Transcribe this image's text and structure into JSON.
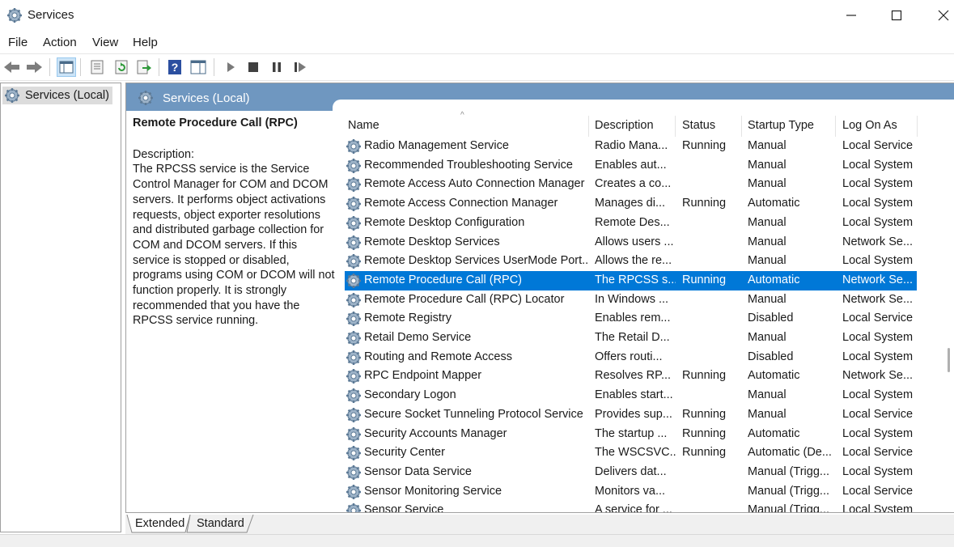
{
  "window": {
    "title": "Services"
  },
  "menu": [
    "File",
    "Action",
    "View",
    "Help"
  ],
  "tree": {
    "root_label": "Services (Local)"
  },
  "main": {
    "header_label": "Services (Local)",
    "selected_service_name": "Remote Procedure Call (RPC)",
    "description_label": "Description:",
    "description_text": "The RPCSS service is the Service Control Manager for COM and DCOM servers. It performs object activations requests, object exporter resolutions and distributed garbage collection for COM and DCOM servers. If this service is stopped or disabled, programs using COM or DCOM will not function properly. It is strongly recommended that you have the RPCSS service running."
  },
  "columns": [
    "Name",
    "Description",
    "Status",
    "Startup Type",
    "Log On As"
  ],
  "services": [
    {
      "name": "Radio Management Service",
      "description": "Radio Mana...",
      "status": "Running",
      "startup": "Manual",
      "logon": "Local Service"
    },
    {
      "name": "Recommended Troubleshooting Service",
      "description": "Enables aut...",
      "status": "",
      "startup": "Manual",
      "logon": "Local System"
    },
    {
      "name": "Remote Access Auto Connection Manager",
      "description": "Creates a co...",
      "status": "",
      "startup": "Manual",
      "logon": "Local System"
    },
    {
      "name": "Remote Access Connection Manager",
      "description": "Manages di...",
      "status": "Running",
      "startup": "Automatic",
      "logon": "Local System"
    },
    {
      "name": "Remote Desktop Configuration",
      "description": "Remote Des...",
      "status": "",
      "startup": "Manual",
      "logon": "Local System"
    },
    {
      "name": "Remote Desktop Services",
      "description": "Allows users ...",
      "status": "",
      "startup": "Manual",
      "logon": "Network Se..."
    },
    {
      "name": "Remote Desktop Services UserMode Port...",
      "description": "Allows the re...",
      "status": "",
      "startup": "Manual",
      "logon": "Local System"
    },
    {
      "name": "Remote Procedure Call (RPC)",
      "description": "The RPCSS s...",
      "status": "Running",
      "startup": "Automatic",
      "logon": "Network Se...",
      "selected": true
    },
    {
      "name": "Remote Procedure Call (RPC) Locator",
      "description": "In Windows ...",
      "status": "",
      "startup": "Manual",
      "logon": "Network Se..."
    },
    {
      "name": "Remote Registry",
      "description": "Enables rem...",
      "status": "",
      "startup": "Disabled",
      "logon": "Local Service"
    },
    {
      "name": "Retail Demo Service",
      "description": "The Retail D...",
      "status": "",
      "startup": "Manual",
      "logon": "Local System"
    },
    {
      "name": "Routing and Remote Access",
      "description": "Offers routi...",
      "status": "",
      "startup": "Disabled",
      "logon": "Local System"
    },
    {
      "name": "RPC Endpoint Mapper",
      "description": "Resolves RP...",
      "status": "Running",
      "startup": "Automatic",
      "logon": "Network Se..."
    },
    {
      "name": "Secondary Logon",
      "description": "Enables start...",
      "status": "",
      "startup": "Manual",
      "logon": "Local System"
    },
    {
      "name": "Secure Socket Tunneling Protocol Service",
      "description": "Provides sup...",
      "status": "Running",
      "startup": "Manual",
      "logon": "Local Service"
    },
    {
      "name": "Security Accounts Manager",
      "description": "The startup ...",
      "status": "Running",
      "startup": "Automatic",
      "logon": "Local System"
    },
    {
      "name": "Security Center",
      "description": "The WSCSVC...",
      "status": "Running",
      "startup": "Automatic (De...",
      "logon": "Local Service"
    },
    {
      "name": "Sensor Data Service",
      "description": "Delivers dat...",
      "status": "",
      "startup": "Manual (Trigg...",
      "logon": "Local System"
    },
    {
      "name": "Sensor Monitoring Service",
      "description": "Monitors va...",
      "status": "",
      "startup": "Manual (Trigg...",
      "logon": "Local Service"
    },
    {
      "name": "Sensor Service",
      "description": "A service for ...",
      "status": "",
      "startup": "Manual (Trigg...",
      "logon": "Local System"
    }
  ],
  "tabs": [
    "Extended",
    "Standard"
  ],
  "colors": {
    "selection": "#0078d7",
    "header_band": "#6f97c0"
  }
}
